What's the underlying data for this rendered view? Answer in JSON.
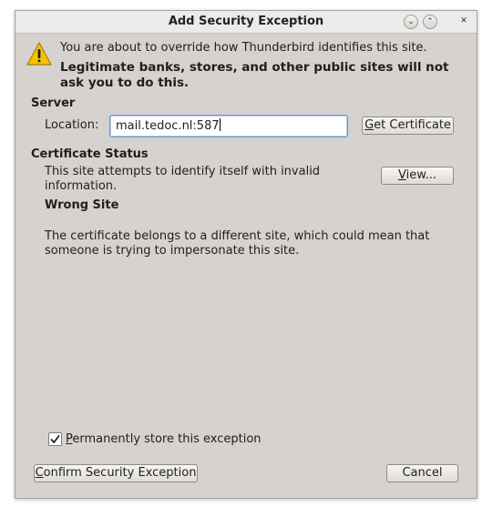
{
  "window": {
    "title": "Add Security Exception"
  },
  "titlebar_buttons": {
    "minimize_glyph": "⌄",
    "maximize_glyph": "⌃",
    "close_glyph": "✕"
  },
  "warning": {
    "icon": "warning-icon",
    "line1": "You are about to override how Thunderbird identifies this site.",
    "line2": "Legitimate banks, stores, and other public sites will not",
    "line3": "ask you to do this."
  },
  "server": {
    "heading": "Server",
    "location_label": "Location:",
    "location_value": "mail.tedoc.nl:587",
    "get_certificate_mnemonic": "G",
    "get_certificate_rest": "et Certificate"
  },
  "certificate_status": {
    "heading": "Certificate Status",
    "description_line1": "This site attempts to identify itself with invalid",
    "description_line2": "information.",
    "view_mnemonic": "V",
    "view_rest": "iew...",
    "problem_title": "Wrong Site",
    "problem_line1": "The certificate belongs to a different site, which could mean that",
    "problem_line2": "someone is trying to impersonate this site."
  },
  "permanent": {
    "checked": true,
    "mnemonic": "P",
    "rest": "ermanently store this exception"
  },
  "footer": {
    "confirm_mnemonic": "C",
    "confirm_rest": "onfirm Security Exception",
    "cancel_label": "Cancel"
  }
}
